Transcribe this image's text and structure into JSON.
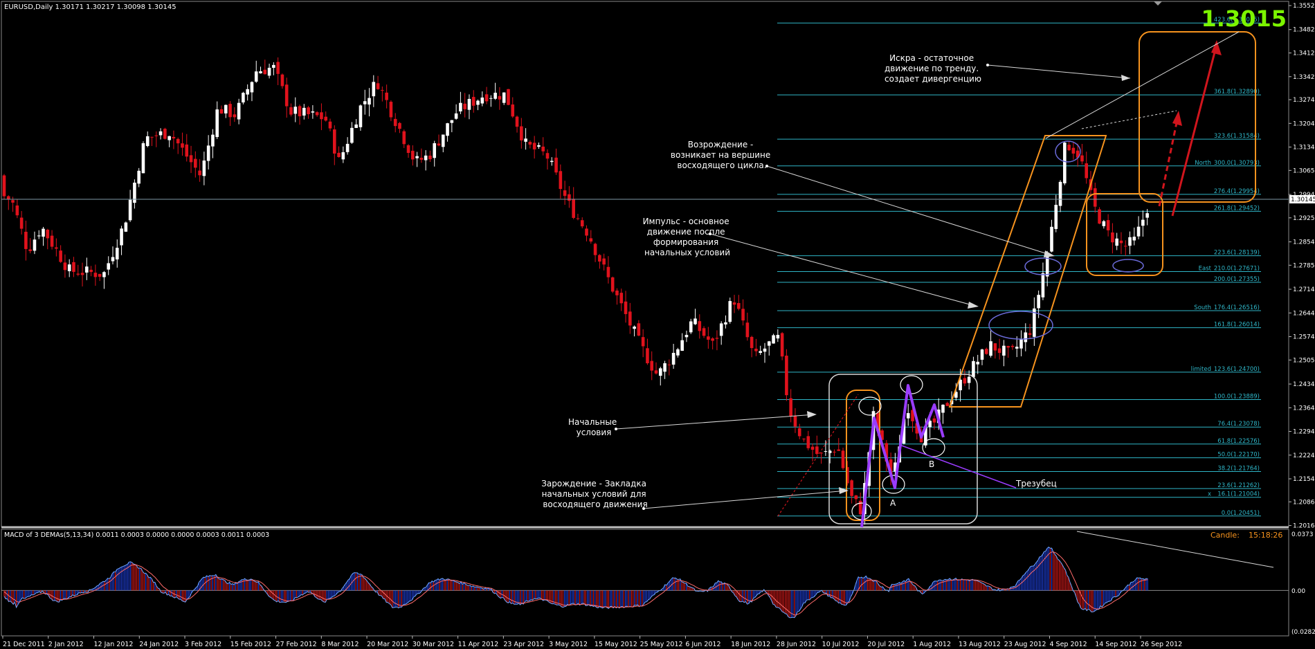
{
  "header": {
    "symbol_line": "EURUSD,Daily  1.30171 1.30217 1.30098 1.30145",
    "big_price": "1.3015",
    "current_price_tag": "1.30145"
  },
  "macd": {
    "title": "MACD of 3 DEMAs(5,13,34) 0.0011 0.0003 0.0000 0.0000 0.0003 0.0011 0.0003",
    "candle_label": "Candle:",
    "candle_timer": "15:18:26",
    "scale_top": "0.0373",
    "scale_zero": "0.00",
    "scale_bottom": "(0.0282)"
  },
  "chart_data": [
    {
      "type": "candlestick",
      "title": "EURUSD,Daily",
      "ylim": [
        1.2016,
        1.3553
      ],
      "y_ticks": [
        "1.35529",
        "1.34820",
        "1.34129",
        "1.33429",
        "1.32749",
        "1.32049",
        "1.31349",
        "1.30659",
        "1.29949",
        "1.29259",
        "1.28549",
        "1.27859",
        "1.27149",
        "1.26449",
        "1.25749",
        "1.25059",
        "1.24349",
        "1.23649",
        "1.22949",
        "1.22249",
        "1.21549",
        "1.20869",
        "1.20169"
      ],
      "x_labels": [
        "21 Dec 2011",
        "2 Jan 2012",
        "12 Jan 2012",
        "24 Jan 2012",
        "3 Feb 2012",
        "15 Feb 2012",
        "27 Feb 2012",
        "8 Mar 2012",
        "20 Mar 2012",
        "30 Mar 2012",
        "11 Apr 2012",
        "23 Apr 2012",
        "3 May 2012",
        "15 May 2012",
        "25 May 2012",
        "6 Jun 2012",
        "18 Jun 2012",
        "28 Jun 2012",
        "10 Jul 2012",
        "20 Jul 2012",
        "1 Aug 2012",
        "13 Aug 2012",
        "23 Aug 2012",
        "4 Sep 2012",
        "14 Sep 2012",
        "26 Sep 2012"
      ],
      "current_price": 1.30145,
      "fib_levels": [
        {
          "label": "423.6(1.35015)",
          "value": 1.35015,
          "tag": ""
        },
        {
          "label": "361.8(1.32890)",
          "value": 1.3289,
          "tag": ""
        },
        {
          "label": "323.6(1.31584)",
          "value": 1.31584,
          "tag": ""
        },
        {
          "label": "300.0(1.30793)",
          "value": 1.30793,
          "tag": "North"
        },
        {
          "label": "276.4(1.29954)",
          "value": 1.29954,
          "tag": ""
        },
        {
          "label": "261.8(1.29452)",
          "value": 1.29452,
          "tag": ""
        },
        {
          "label": "223.6(1.28139)",
          "value": 1.28139,
          "tag": ""
        },
        {
          "label": "210.0(1.27671)",
          "value": 1.27671,
          "tag": "East"
        },
        {
          "label": "200.0(1.27355)",
          "value": 1.27355,
          "tag": ""
        },
        {
          "label": "176.4(1.26516)",
          "value": 1.26516,
          "tag": "South"
        },
        {
          "label": "161.8(1.26014)",
          "value": 1.26014,
          "tag": ""
        },
        {
          "label": "123.6(1.24700)",
          "value": 1.247,
          "tag": "limited"
        },
        {
          "label": "100.0(1.23889)",
          "value": 1.23889,
          "tag": ""
        },
        {
          "label": "76.4(1.23078)",
          "value": 1.23078,
          "tag": ""
        },
        {
          "label": "61.8(1.22576)",
          "value": 1.22576,
          "tag": ""
        },
        {
          "label": "50.0(1.22170)",
          "value": 1.2217,
          "tag": ""
        },
        {
          "label": "38.2(1.21764)",
          "value": 1.21764,
          "tag": ""
        },
        {
          "label": "23.6(1.21262)",
          "value": 1.21262,
          "tag": ""
        },
        {
          "label": "16.1(1.21004)",
          "value": 1.21004,
          "tag": "x"
        },
        {
          "label": "0.0(1.20451)",
          "value": 1.20451,
          "tag": ""
        }
      ],
      "annotations": [
        {
          "text": "Искра - остаточное движение по тренду. создает дивергенцию"
        },
        {
          "text": "Возрождение - возникает на вершине восходящего цикла."
        },
        {
          "text": "Импульс - основное движение поспле формирования начальных условий"
        },
        {
          "text": "Начальные условия"
        },
        {
          "text": "Зарождение - Закладка начальных условий для восходящего движения"
        },
        {
          "text": "Трезубец"
        },
        {
          "text": "A"
        },
        {
          "text": "B"
        }
      ],
      "colors": {
        "bull": "#ffffff",
        "bear": "#e0121c",
        "fib": "#2fb6c8",
        "channel": "#f7931e",
        "big_price": "#7cf400",
        "pitchfork": "#9933ff"
      }
    },
    {
      "type": "histogram",
      "title": "MACD of 3 DEMAs(5,13,34)",
      "ylim": [
        -0.0282,
        0.0373
      ],
      "colors": {
        "up": "#1f3fd6",
        "down": "#d11a1a",
        "line_fast": "#6fa7ff",
        "line_slow": "#ff6b6b"
      }
    }
  ]
}
